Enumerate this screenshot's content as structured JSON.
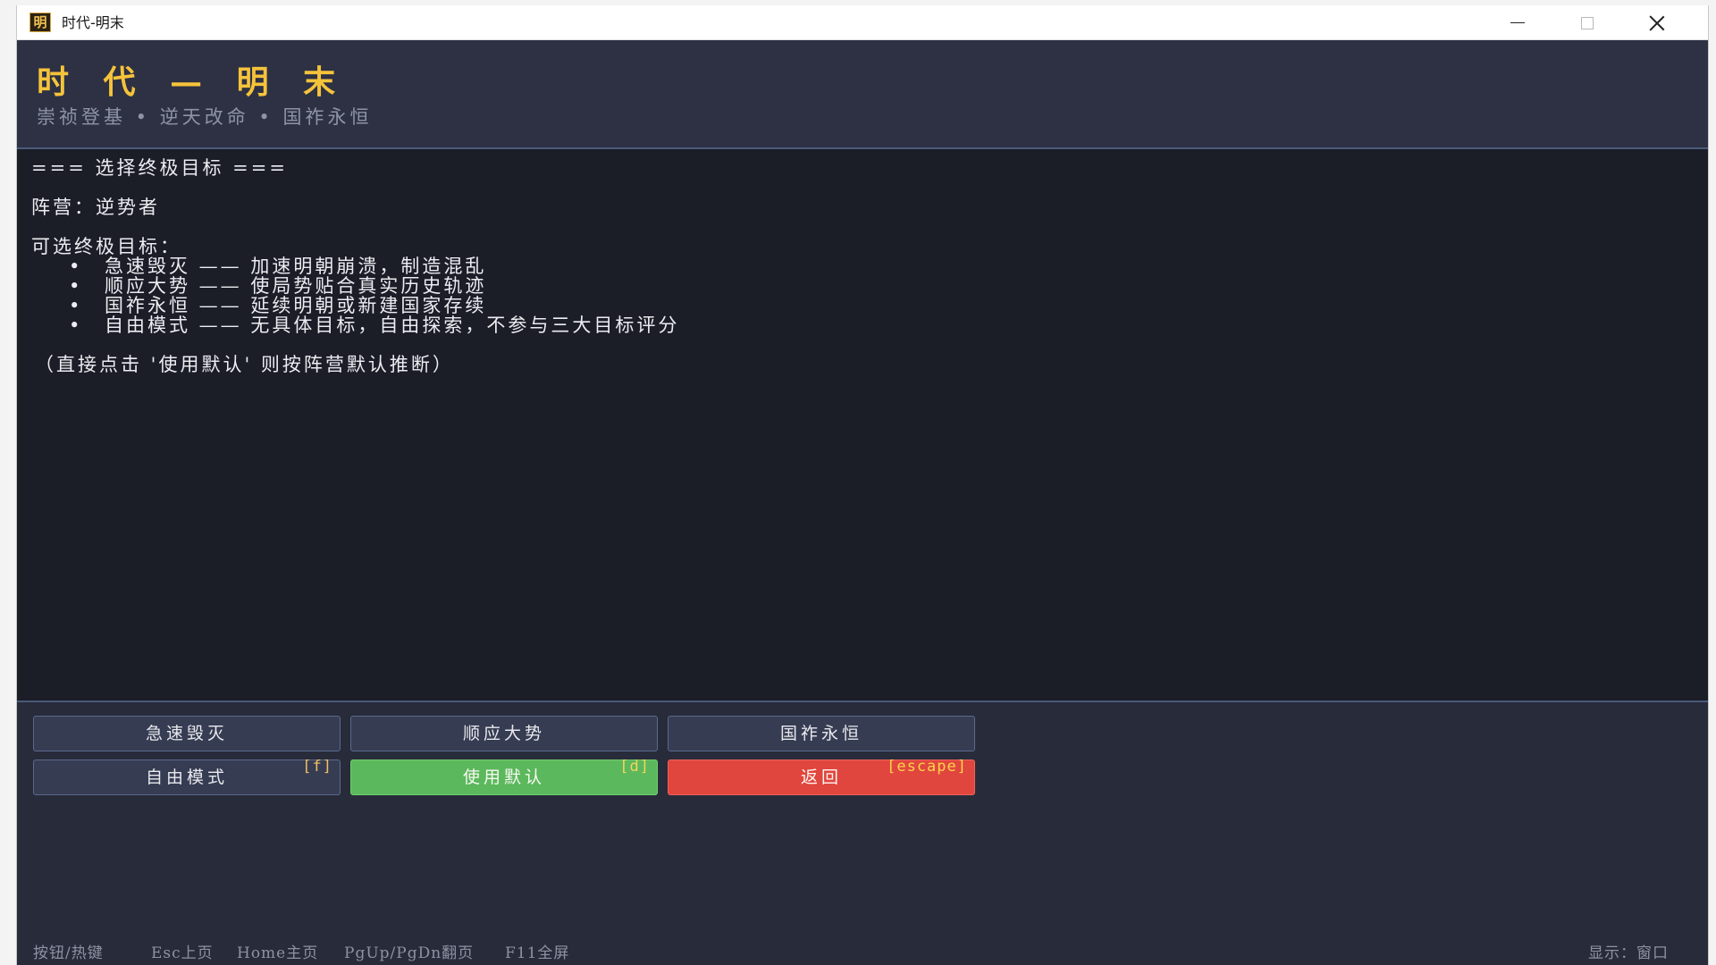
{
  "window": {
    "title": "时代-明末",
    "icon_glyph": "明",
    "controls": [
      "minimize-icon",
      "maximize-icon",
      "close-icon"
    ]
  },
  "header": {
    "title": "时 代 — 明 末",
    "subtitle": "崇祯登基 • 逆天改命 • 国祚永恒"
  },
  "content": {
    "heading": "=== 选择终极目标 ===",
    "faction_line": "阵营：逆势者",
    "options_heading": "可选终极目标：",
    "options": [
      "急速毁灭 —— 加速明朝崩溃，制造混乱",
      "顺应大势 —— 使局势贴合真实历史轨迹",
      "国祚永恒 —— 延续明朝或新建国家存续",
      "自由模式 —— 无具体目标，自由探索，不参与三大目标评分"
    ],
    "bullet": "•",
    "note": "（直接点击 '使用默认' 则按阵营默认推断）"
  },
  "buttons": {
    "rapid_destroy": "急速毁灭",
    "follow_trend": "顺应大势",
    "eternal_state": "国祚永恒",
    "free_mode": "自由模式",
    "free_mode_hotkey": "[f]",
    "use_default": "使用默认",
    "use_default_hotkey": "[d]",
    "back": "返回",
    "back_hotkey": "[escape]"
  },
  "colors": {
    "accent_gold": "#f5c33b",
    "default_button": "#5cb85c",
    "back_button": "#e0463d"
  },
  "statusbar": {
    "buttons_hotkeys": "按钮/热键",
    "esc_home": "Esc上页",
    "home_main": "Home主页",
    "page_nav": "PgUp/PgDn翻页",
    "fullscreen": "F11全屏",
    "display_mode": "显示：窗口"
  }
}
